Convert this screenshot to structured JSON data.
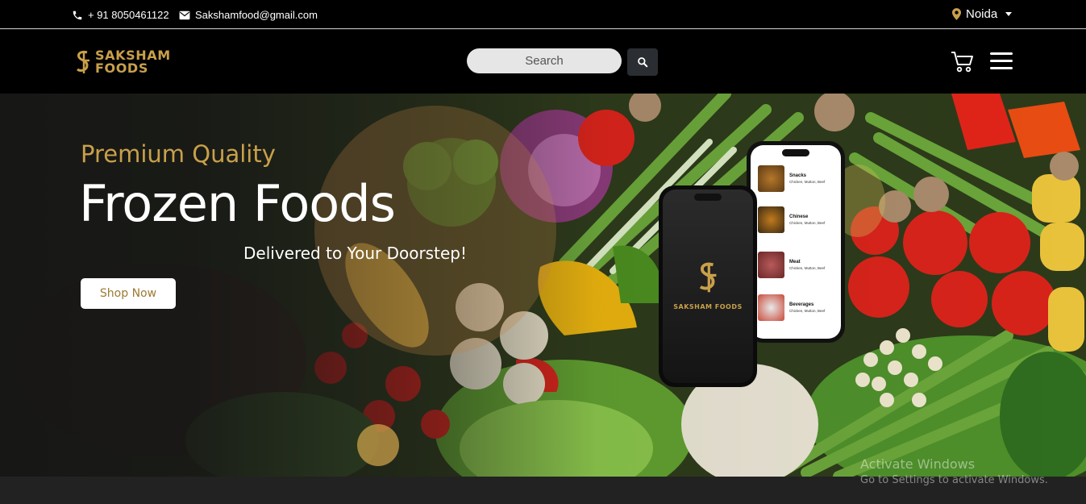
{
  "topbar": {
    "phone": "+ 91 8050461122",
    "email": "Sakshamfood@gmail.com",
    "location": "Noida"
  },
  "header": {
    "logo_line1": "SAKSHAM",
    "logo_line2": "FOODS",
    "search_placeholder": "Search",
    "icons": [
      "phone-icon",
      "mail-icon",
      "location-pin-icon",
      "search-icon",
      "cart-icon",
      "menu-icon"
    ]
  },
  "hero": {
    "subtitle": "Premium Quality",
    "title": "Frozen Foods",
    "tagline": "Delivered to Your Doorstep!",
    "cta": "Shop Now",
    "phone_brand": "SAKSHAM FOODS",
    "categories": [
      {
        "name": "Snacks",
        "desc": "Chicken, Mutton, Beef"
      },
      {
        "name": "Chinese",
        "desc": "Chicken, Mutton, Beef"
      },
      {
        "name": "Meat",
        "desc": "Chicken, Mutton, Beef"
      },
      {
        "name": "Beverages",
        "desc": "Chicken, Mutton, Beef"
      }
    ]
  },
  "watermark": {
    "line1": "Activate Windows",
    "line2": "Go to Settings to activate Windows."
  },
  "colors": {
    "gold": "#c9a04a",
    "black": "#000000",
    "dark": "#1f1f1f"
  }
}
